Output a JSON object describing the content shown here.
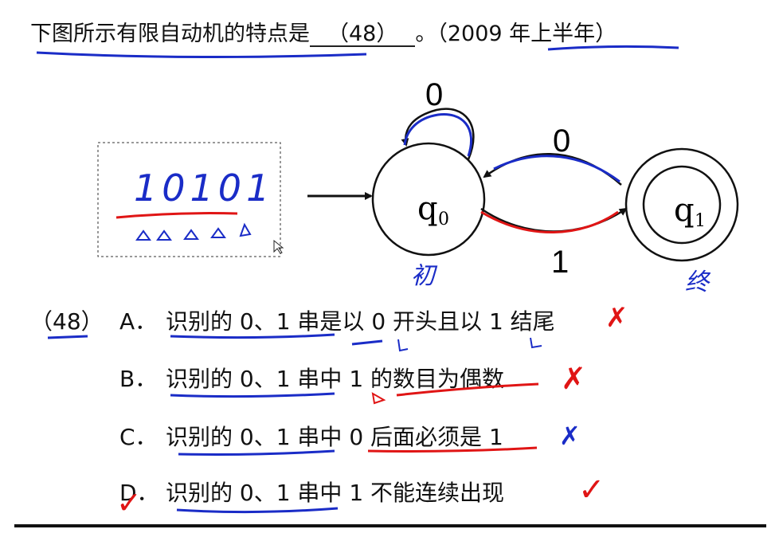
{
  "question": {
    "prefix": "下图所示有限自动机的特点是",
    "blank_number": "（48）",
    "suffix": "。（2009 年上半年）"
  },
  "automaton": {
    "states": [
      {
        "name": "q",
        "sub": "0",
        "initial": true,
        "accepting": false
      },
      {
        "name": "q",
        "sub": "1",
        "initial": false,
        "accepting": true
      }
    ],
    "transitions": [
      {
        "from": "q0",
        "to": "q0",
        "label": "0"
      },
      {
        "from": "q0",
        "to": "q1",
        "label": "1"
      },
      {
        "from": "q1",
        "to": "q0",
        "label": "0"
      }
    ]
  },
  "options": {
    "number": "（48）",
    "items": [
      {
        "label": "A．",
        "text": "识别的 0、1 串是以 0 开头且以 1 结尾"
      },
      {
        "label": "B．",
        "text": "识别的 0、1 串中 1 的数目为偶数"
      },
      {
        "label": "C．",
        "text": "识别的 0、1 串中 0 后面必须是 1"
      },
      {
        "label": "D．",
        "text": "识别的 0、1 串中 1 不能连续出现"
      }
    ]
  },
  "annotations": {
    "sample_string": "10101",
    "initial_note": "初",
    "final_note": "终",
    "marks": [
      "✗",
      "✗",
      "✗",
      "✓",
      "✓"
    ],
    "colors": {
      "blue_ink": "#1a2cc7",
      "red_ink": "#e01515",
      "black": "#111111"
    }
  }
}
